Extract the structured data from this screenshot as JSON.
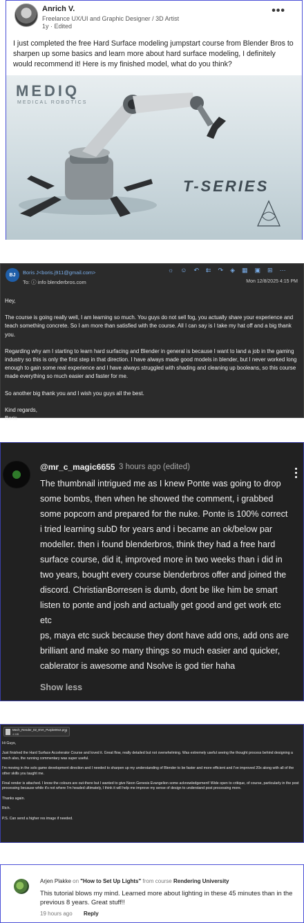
{
  "linkedin_post": {
    "author_name": "Anrich V.",
    "author_title": "Freelance UX/UI and Graphic Designer / 3D Artist",
    "meta": "1y · Edited",
    "more_icon": "more-horizontal-icon",
    "text": "I just completed the free Hard Surface modeling jumpstart course from Blender Bros to sharpen up some basics and learn more about hard surface modeling, I definitely would recommend it! Here is my finished model, what do you think?",
    "image": {
      "brand": "MEDIQ",
      "brand_sub": "MEDICAL ROBOTICS",
      "series": "T-SERIES"
    }
  },
  "email_1": {
    "avatar_initials": "BJ",
    "from": "Boris J<boris.j911@gmail.com>",
    "to": "To:  ⓘ info blenderbros.com",
    "date": "Mon 12/8/2025 4:15 PM",
    "toolbar_icons": [
      "lightbulb-icon",
      "emoji-icon",
      "reply-icon",
      "reply-all-icon",
      "forward-icon",
      "copilot-icon",
      "calendar-icon",
      "move-icon",
      "apps-icon",
      "more-icon"
    ],
    "greeting": "Hey,",
    "p1": "The course is going really well, I am learning so much. You guys do not sell fog, you actually share your experience and teach something concrete. So I am more than satisfied with the course. All I can say is I take my hat off and a big thank you.",
    "p2": "Regarding why am I starting to learn hard surfacing and Blender in general is because I want to land a job in the gaming industry so this is only the first step in that direction. I have always made good models in blender, but I never worked long enough to gain some real experience and I have always struggled with shading and cleaning up booleans, so this course made everything so much easier and faster for me.",
    "p3": "So another big thank you and I wish you guys all the best.",
    "signoff": "Kind regards,",
    "signature": "Boris"
  },
  "youtube_comment": {
    "handle": "@mr_c_magic6655",
    "time": "3 hours ago (edited)",
    "text": "The thumbnail intrigued me as I knew Ponte was going to drop some bombs, then when he showed the comment, i grabbed some popcorn and prepared for the nuke. Ponte is 100% correct i tried learning subD for years and i became an ok/below par modeller. then i found blenderbros, think they had a free hard surface course, did it, improved more in two weeks than i did in two years, bought every course blenderbros offer and joined the discord. ChristianBorresen is dumb, dont be like him be smart listen to ponte and josh and actually get good and get work etc etc\nps, maya etc suck because they dont have add ons, add ons are brilliant and make so many things so much easier and quicker, cablerator is awesome and Nsolve is god tier haha",
    "show_less": "Show less"
  },
  "email_2": {
    "attachment_name": "Mech_Render_02_EVA_Purple00v2.png",
    "attachment_size": "4 MB",
    "greeting": "Hi Guys,",
    "p1": "Just finished the Hard Surface Accelerator Course and loved it. Great flow, really detailed but not overwhelming. Was extremely useful seeing the thought process behind designing a mech also, the running commentary was super useful.",
    "p2": "I'm moving in the solo game development direction and I needed to sharpen up my understanding of Blender to be faster and more efficient and I've improved 20x along with all of the other skills you taught me.",
    "p3": "Final render is attached. I know the colours are out-there but I wanted to give Neon Genesis Evangelion some acknowledgement! Wide open to critique, of course, particularly in the post processing because while it's not where I'm headed ultimately, I think it will help me improve my sense of design to understand post processing more.",
    "p4": "Thanks again.",
    "p5": "Rich.",
    "p6": "P.S. Can send a higher res image if needed."
  },
  "course_comment": {
    "author": "Arjen Plakke",
    "on": " on ",
    "lesson": "\"How to Set Up Lights\"",
    "from_course": " from course ",
    "course": "Rendering University",
    "text": "This tutorial blows my mind. Learned more about lighting in these 45 minutes than in the previous 8 years. Great stuff!!",
    "time": "19 hours ago",
    "reply": "Reply"
  }
}
